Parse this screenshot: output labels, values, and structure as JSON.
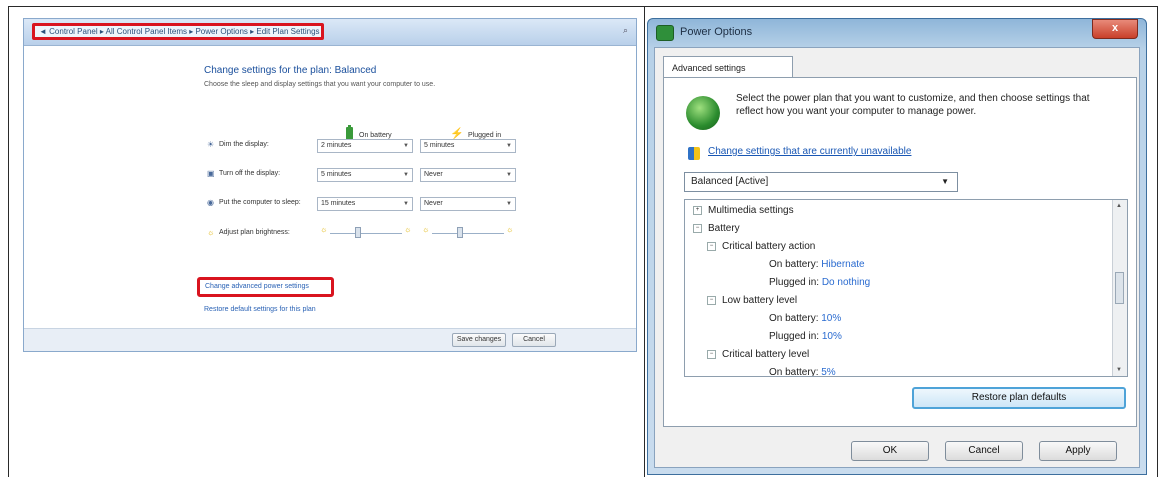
{
  "left": {
    "breadcrumb": "◄ Control Panel ▸ All Control Panel Items ▸ Power Options ▸ Edit Plan Settings",
    "heading": "Change settings for the plan: Balanced",
    "subheading": "Choose the sleep and display settings that you want your computer to use.",
    "col_battery": "On battery",
    "col_plugged": "Plugged in",
    "rows": [
      {
        "label": "Dim the display:",
        "battery": "2 minutes",
        "plugged": "5 minutes"
      },
      {
        "label": "Turn off the display:",
        "battery": "5 minutes",
        "plugged": "Never"
      },
      {
        "label": "Put the computer to sleep:",
        "battery": "15 minutes",
        "plugged": "Never"
      },
      {
        "label": "Adjust plan brightness:",
        "battery": "",
        "plugged": ""
      }
    ],
    "change_advanced": "Change advanced power settings",
    "restore_link": "Restore default settings for this plan",
    "save_button": "Save changes",
    "cancel_button": "Cancel"
  },
  "right": {
    "title": "Power Options",
    "close": "x",
    "tab": "Advanced settings",
    "intro": "Select the power plan that you want to customize, and then choose settings that reflect how you want your computer to manage power.",
    "change_link": "Change settings that are currently unavailable",
    "plan": "Balanced [Active]",
    "tree": [
      {
        "indent": 0,
        "toggle": "+",
        "label": "Multimedia settings",
        "value": ""
      },
      {
        "indent": 0,
        "toggle": "−",
        "label": "Battery",
        "value": ""
      },
      {
        "indent": 1,
        "toggle": "−",
        "label": "Critical battery action",
        "value": ""
      },
      {
        "indent": 2,
        "toggle": "",
        "label": "On battery:",
        "value": "Hibernate"
      },
      {
        "indent": 2,
        "toggle": "",
        "label": "Plugged in:",
        "value": "Do nothing"
      },
      {
        "indent": 1,
        "toggle": "−",
        "label": "Low battery level",
        "value": ""
      },
      {
        "indent": 2,
        "toggle": "",
        "label": "On battery:",
        "value": "10%"
      },
      {
        "indent": 2,
        "toggle": "",
        "label": "Plugged in:",
        "value": "10%"
      },
      {
        "indent": 1,
        "toggle": "−",
        "label": "Critical battery level",
        "value": ""
      },
      {
        "indent": 2,
        "toggle": "",
        "label": "On battery:",
        "value": "5%"
      }
    ],
    "restore_defaults": "Restore plan defaults",
    "ok": "OK",
    "cancel": "Cancel",
    "apply": "Apply"
  }
}
